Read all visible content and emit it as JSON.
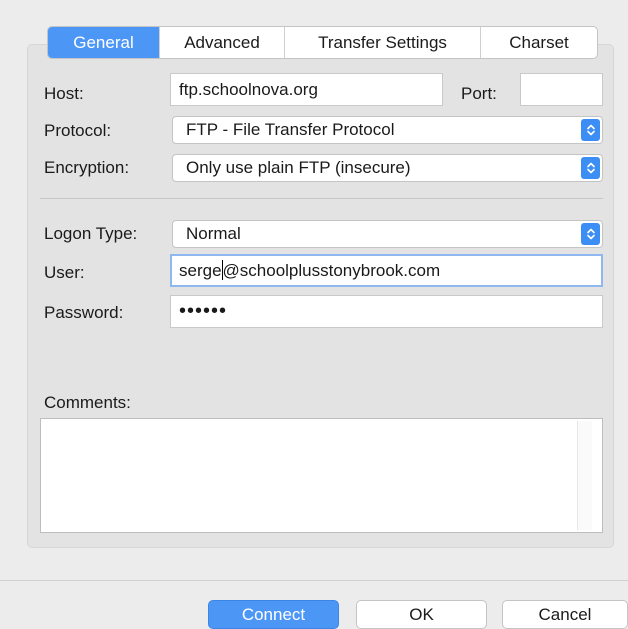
{
  "tabs": [
    {
      "label": "General",
      "active": true
    },
    {
      "label": "Advanced",
      "active": false
    },
    {
      "label": "Transfer Settings",
      "active": false
    },
    {
      "label": "Charset",
      "active": false
    }
  ],
  "form": {
    "host_label": "Host:",
    "host_value": "ftp.schoolnova.org",
    "port_label": "Port:",
    "port_value": "",
    "protocol_label": "Protocol:",
    "protocol_value": "FTP - File Transfer Protocol",
    "encryption_label": "Encryption:",
    "encryption_value": "Only use plain FTP (insecure)",
    "logon_type_label": "Logon Type:",
    "logon_type_value": "Normal",
    "user_label": "User:",
    "user_value_before_caret": "serge",
    "user_value_after_caret": "@schoolplusstonybrook.com",
    "password_label": "Password:",
    "password_value": "••••••",
    "comments_label": "Comments:",
    "comments_value": ""
  },
  "buttons": {
    "connect": "Connect",
    "ok": "OK",
    "cancel": "Cancel"
  },
  "colors": {
    "accent": "#4c96f5",
    "select_arrow": "#3d8ef4"
  }
}
